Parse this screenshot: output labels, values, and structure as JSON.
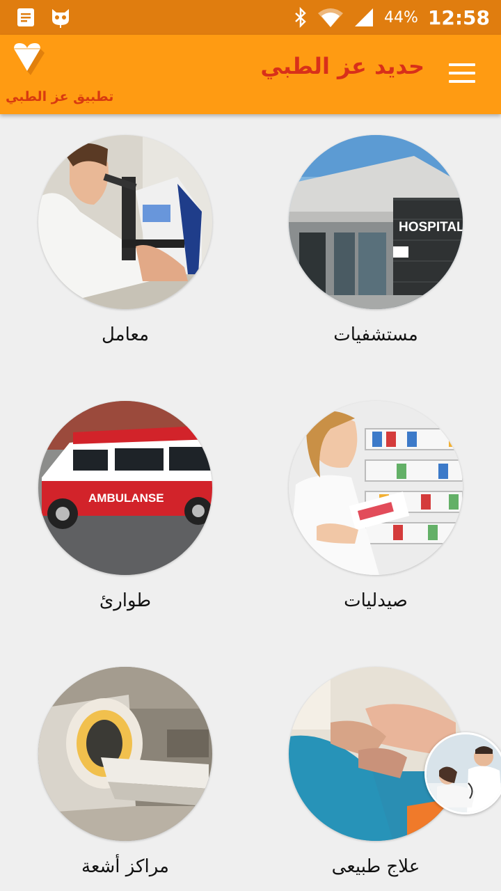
{
  "status_bar": {
    "battery_percent": "44%",
    "time": "12:58",
    "icons": [
      "notes-notification-icon",
      "cat-notification-icon",
      "bluetooth-icon",
      "wifi-icon",
      "signal-icon"
    ]
  },
  "app_bar": {
    "title": "حديد عز الطبي",
    "logo_caption": "تطبيق عز الطبي",
    "accent_color": "#ff9b12",
    "status_color": "#e07d0f",
    "title_color": "#d8301a"
  },
  "grid": {
    "items": [
      {
        "label": "مستشفيات",
        "image": "hospital-photo"
      },
      {
        "label": "معامل",
        "image": "lab-microscope-photo"
      },
      {
        "label": "صيدليات",
        "image": "pharmacy-photo"
      },
      {
        "label": "طوارئ",
        "image": "ambulance-photo"
      },
      {
        "label": "علاج طبيعى",
        "image": "physiotherapy-photo"
      },
      {
        "label": "مراكز أشعة",
        "image": "mri-scanner-photo"
      }
    ],
    "ambulance_text": "AMBULANSE",
    "hospital_sign": "HOSPITAL"
  }
}
